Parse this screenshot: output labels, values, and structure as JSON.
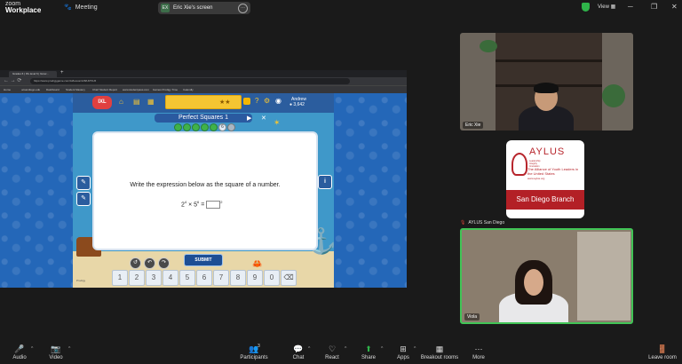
{
  "app": {
    "logo_line1": "zoom",
    "logo_line2": "Workplace",
    "meeting_label": "Meeting",
    "share_badge": "EX",
    "share_title": "Eric Xie's screen",
    "view_label": "View",
    "window_controls": [
      "─",
      "❐",
      "✕"
    ]
  },
  "browser": {
    "tab_title": "Grades 6 | IXL level 6 | Grow...",
    "new_tab": "+",
    "url": "https://www.prodigygame.com/ixl/lesson/A/8/L8/7/1/6",
    "bookmarks": [
      "Home",
      "ucsandiego.edu",
      "Dashboard",
      "Student Mastery",
      "Chief Student Report",
      "www.studentpass.com",
      "Games Prodigy Time",
      "Calendly"
    ]
  },
  "game": {
    "brand": "IXL",
    "username": "Andrew",
    "coins": "3,642",
    "skill_title": "Perfect Squares 1",
    "progress": {
      "completed": 5,
      "current_label": "6",
      "total": 7
    },
    "prompt": "Write the expression below as the square of a number.",
    "expression": {
      "base1": "2",
      "exp1": "4",
      "op": "×",
      "base2": "5",
      "exp2": "6",
      "equals": "=",
      "result_exp": "2"
    },
    "side_left": [
      "✎",
      "✎"
    ],
    "side_right_icon": "i",
    "controls": [
      "↺",
      "↶",
      "↷"
    ],
    "submit_label": "SUBMIT",
    "keypad": [
      "1",
      "2",
      "3",
      "4",
      "5",
      "6",
      "7",
      "8",
      "9",
      "0",
      "⌫"
    ],
    "footer_text": "Prodigy"
  },
  "participants": {
    "tile1_name": "Eric Xie",
    "tile2_name": "AYLUS San Diego",
    "tile3_name": "Viola",
    "aylus": {
      "name": "AYLUS",
      "sub": "Leadership Integrity Innovation",
      "tagline": "The Alliance of Youth Leaders in the United States",
      "site": "www.aylus.org",
      "branch": "San Diego Branch"
    }
  },
  "toolbar": {
    "audio": "Audio",
    "video": "Video",
    "participants": "Participants",
    "participants_count": "3",
    "chat": "Chat",
    "react": "React",
    "share": "Share",
    "apps": "Apps",
    "breakout": "Breakout rooms",
    "more": "More",
    "leave": "Leave room",
    "icons": {
      "audio": "🎤",
      "video": "📷",
      "participants": "👥",
      "chat": "💬",
      "react": "♡",
      "share": "⬆",
      "apps": "⊞",
      "breakout": "▦",
      "more": "⋯",
      "leave": "🚪"
    },
    "colors": {
      "muted": "#e0443a",
      "share": "#2fb34a"
    }
  }
}
